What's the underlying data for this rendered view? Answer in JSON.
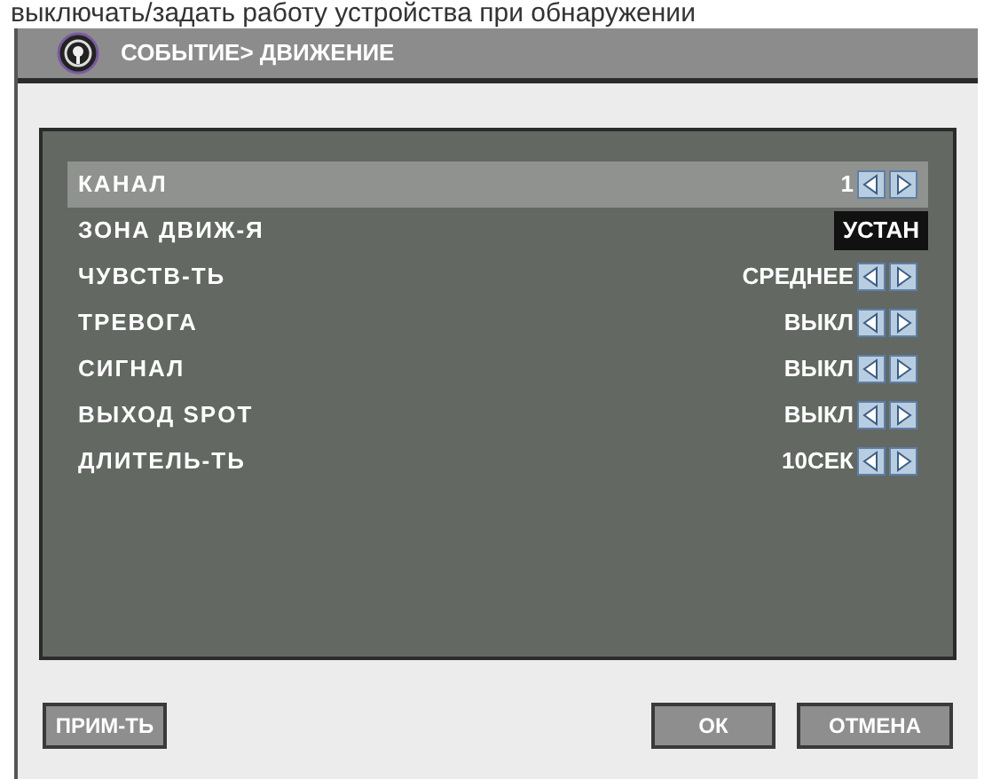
{
  "page_caption": "выключать/задать работу устройства при обнаружении",
  "window": {
    "title": "СОБЫТИЕ> ДВИЖЕНИЕ"
  },
  "rows": [
    {
      "label": "КАНАЛ",
      "value": "1",
      "kind": "selector",
      "selected": true
    },
    {
      "label": "ЗОНА ДВИЖ-Я",
      "value": "УСТАН",
      "kind": "button",
      "selected": false
    },
    {
      "label": "ЧУВСТВ-ТЬ",
      "value": "СРЕДНЕЕ",
      "kind": "selector",
      "selected": false
    },
    {
      "label": "ТРЕВОГА",
      "value": "ВЫКЛ",
      "kind": "selector",
      "selected": false
    },
    {
      "label": "СИГНАЛ",
      "value": "ВЫКЛ",
      "kind": "selector",
      "selected": false
    },
    {
      "label": "ВЫХОД SPOT",
      "value": "ВЫКЛ",
      "kind": "selector",
      "selected": false
    },
    {
      "label": "ДЛИТЕЛЬ-ТЬ",
      "value": "10СЕК",
      "kind": "selector",
      "selected": false
    }
  ],
  "buttons": {
    "left": [
      "ПРИМ-ТЬ"
    ],
    "right": [
      "ОК",
      "ОТМЕНА"
    ]
  }
}
